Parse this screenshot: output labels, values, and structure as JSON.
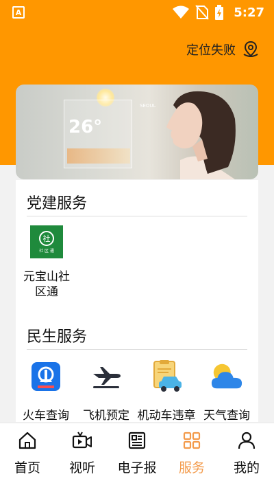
{
  "status_bar": {
    "time": "5:27",
    "notification_icon": "A",
    "icons": [
      "wifi-icon",
      "no-sim-icon",
      "battery-icon"
    ]
  },
  "location": {
    "text": "定位失败",
    "icon": "location-pin-icon"
  },
  "banner": {
    "weather_city": "SEOUL",
    "weather_temp": "26°"
  },
  "party_section": {
    "title": "党建服务",
    "items": [
      {
        "label": "元宝山社区通",
        "icon": "community-app-icon",
        "icon_text": "社",
        "icon_subtext": "社 区 通"
      }
    ]
  },
  "livelihood_section": {
    "title": "民生服务",
    "items": [
      {
        "label": "火车查询",
        "icon": "train-icon"
      },
      {
        "label": "飞机预定",
        "icon": "airplane-icon"
      },
      {
        "label": "机动车违章",
        "icon": "car-violation-icon"
      },
      {
        "label": "天气查询",
        "icon": "weather-icon"
      }
    ]
  },
  "bottom_nav": {
    "active_color": "#f39a4a",
    "items": [
      {
        "label": "首页",
        "icon": "home-icon"
      },
      {
        "label": "视听",
        "icon": "video-icon"
      },
      {
        "label": "电子报",
        "icon": "newspaper-icon"
      },
      {
        "label": "服务",
        "icon": "grid-icon",
        "active": true
      },
      {
        "label": "我的",
        "icon": "person-icon"
      }
    ]
  },
  "colors": {
    "header_orange": "#ff9700",
    "accent": "#f39a4a"
  }
}
